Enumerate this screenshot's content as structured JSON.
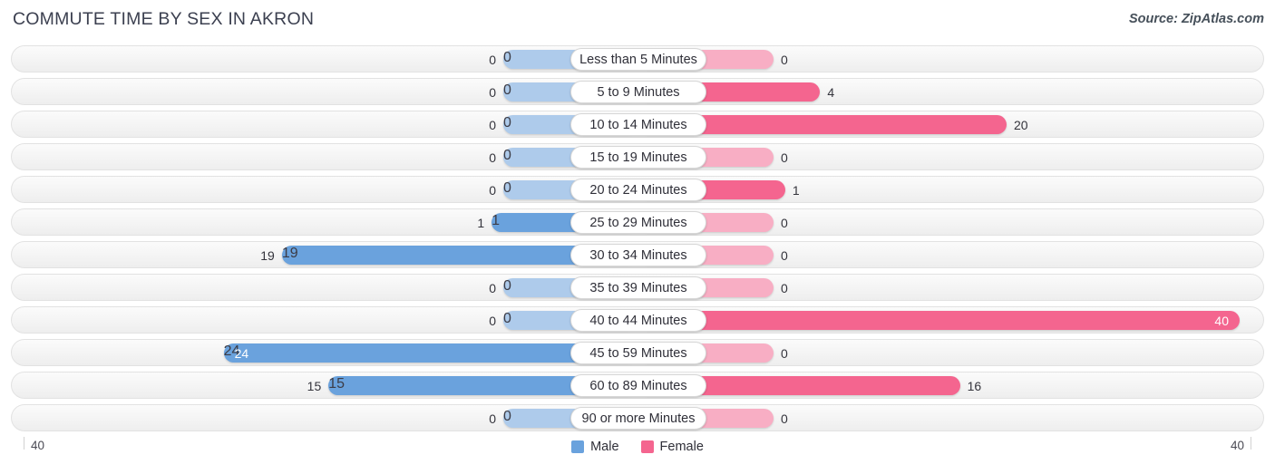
{
  "header": {
    "title": "COMMUTE TIME BY SEX IN AKRON",
    "source": "Source: ZipAtlas.com"
  },
  "axis": {
    "left_tick": "40",
    "right_tick": "40"
  },
  "legend": {
    "items": [
      {
        "label": "Male",
        "color": "#6aa2dd"
      },
      {
        "label": "Female",
        "color": "#f4658f"
      }
    ]
  },
  "colors": {
    "male": "#6aa2dd",
    "male_zero": "#aecbeb",
    "female": "#f4658f",
    "female_zero": "#f8aec4",
    "row_bg": "#f4f4f4",
    "text": "#3c3c46"
  },
  "chart_data": {
    "type": "bar",
    "orientation": "horizontal",
    "layout": "diverging-bidirectional",
    "title": "COMMUTE TIME BY SEX IN AKRON",
    "xlabel": "",
    "ylabel": "",
    "xlim": [
      40,
      40
    ],
    "grid": false,
    "legend_position": "bottom-center",
    "categories": [
      "Less than 5 Minutes",
      "5 to 9 Minutes",
      "10 to 14 Minutes",
      "15 to 19 Minutes",
      "20 to 24 Minutes",
      "25 to 29 Minutes",
      "30 to 34 Minutes",
      "35 to 39 Minutes",
      "40 to 44 Minutes",
      "45 to 59 Minutes",
      "60 to 89 Minutes",
      "90 or more Minutes"
    ],
    "series": [
      {
        "name": "Male",
        "color": "#6aa2dd",
        "values": [
          0,
          0,
          0,
          0,
          0,
          1,
          19,
          0,
          0,
          24,
          15,
          0
        ]
      },
      {
        "name": "Female",
        "color": "#f4658f",
        "values": [
          0,
          4,
          20,
          0,
          1,
          0,
          0,
          0,
          40,
          0,
          16,
          0
        ]
      }
    ]
  },
  "rows": [
    {
      "label": "Less than 5 Minutes",
      "male": "0",
      "female": "0",
      "male_inside": false,
      "female_inside": false
    },
    {
      "label": "5 to 9 Minutes",
      "male": "0",
      "female": "4",
      "male_inside": false,
      "female_inside": false
    },
    {
      "label": "10 to 14 Minutes",
      "male": "0",
      "female": "20",
      "male_inside": false,
      "female_inside": false
    },
    {
      "label": "15 to 19 Minutes",
      "male": "0",
      "female": "0",
      "male_inside": false,
      "female_inside": false
    },
    {
      "label": "20 to 24 Minutes",
      "male": "0",
      "female": "1",
      "male_inside": false,
      "female_inside": false
    },
    {
      "label": "25 to 29 Minutes",
      "male": "1",
      "female": "0",
      "male_inside": false,
      "female_inside": false
    },
    {
      "label": "30 to 34 Minutes",
      "male": "19",
      "female": "0",
      "male_inside": false,
      "female_inside": false
    },
    {
      "label": "35 to 39 Minutes",
      "male": "0",
      "female": "0",
      "male_inside": false,
      "female_inside": false
    },
    {
      "label": "40 to 44 Minutes",
      "male": "0",
      "female": "40",
      "male_inside": false,
      "female_inside": true
    },
    {
      "label": "45 to 59 Minutes",
      "male": "24",
      "female": "0",
      "male_inside": true,
      "female_inside": false
    },
    {
      "label": "60 to 89 Minutes",
      "male": "15",
      "female": "16",
      "male_inside": false,
      "female_inside": false
    },
    {
      "label": "90 or more Minutes",
      "male": "0",
      "female": "0",
      "male_inside": false,
      "female_inside": false
    }
  ]
}
